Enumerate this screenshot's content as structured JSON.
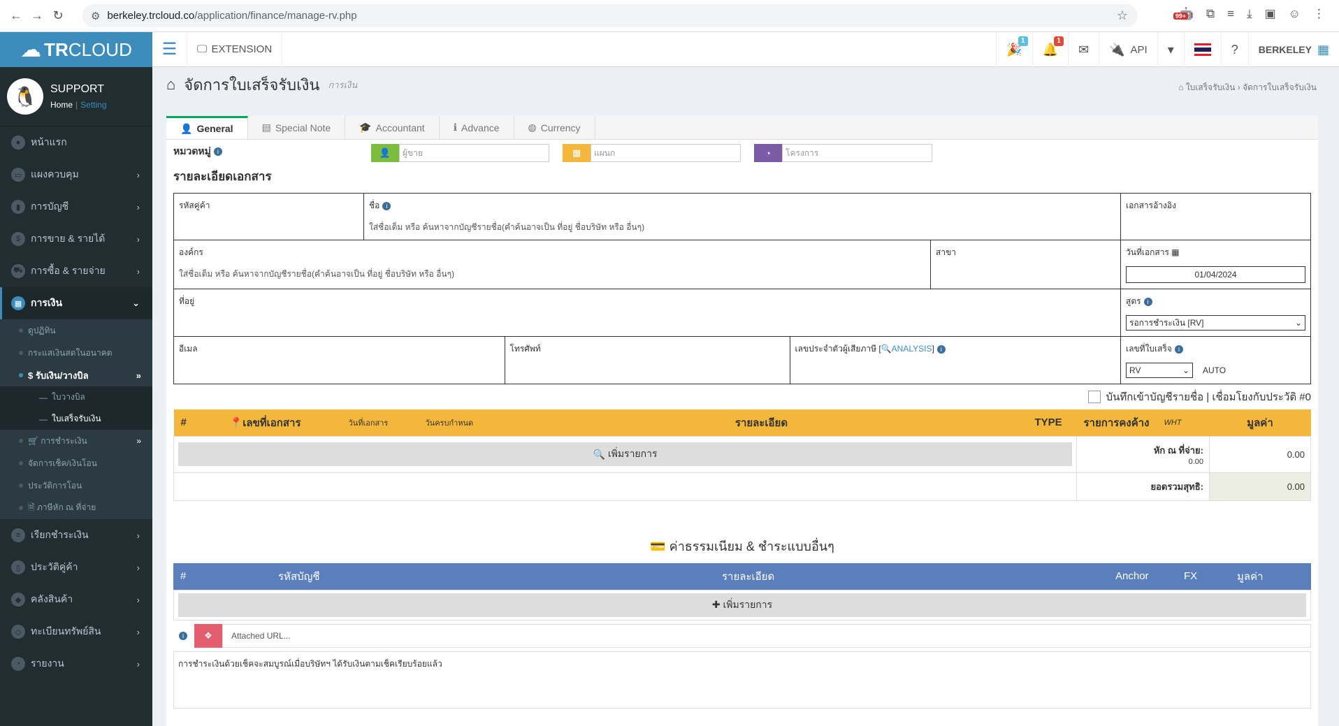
{
  "browser": {
    "url_host": "berkeley.trcloud.co",
    "url_path": "/application/finance/manage-rv.php",
    "ext_badge": "99+"
  },
  "brand": {
    "logo_bold": "TR",
    "logo_thin": "CLOUD"
  },
  "topnav": {
    "extension": "EXTENSION",
    "api": "API",
    "notify_badge": "1",
    "party_badge": "1",
    "user": "BERKELEY"
  },
  "user": {
    "name": "SUPPORT",
    "home": "Home",
    "sep": "|",
    "setting": "Setting"
  },
  "menu": [
    {
      "label": "หน้าแรก",
      "chev": ""
    },
    {
      "label": "แผงควบคุม",
      "chev": "›"
    },
    {
      "label": "การบัญชี",
      "chev": "›"
    },
    {
      "label": "การขาย & รายได้",
      "chev": "›"
    },
    {
      "label": "การซื้อ & รายจ่าย",
      "chev": "›"
    }
  ],
  "menu_active": {
    "label": "การเงิน",
    "chev": "⌄"
  },
  "submenu": [
    "ดูปฏิทิน",
    "กระแสเงินสดในอนาคต"
  ],
  "sub_active": {
    "label": "$ รับเงิน/วางบิล",
    "chev": "»"
  },
  "subsub": [
    "ใบวางบิล",
    "ใบเสร็จรับเงิน"
  ],
  "submenu2": [
    {
      "label": "🛒 การชำระเงิน",
      "chev": "»"
    },
    {
      "label": "จัดการเช็ค/เงินโอน",
      "chev": ""
    },
    {
      "label": "ประวัติการโอน",
      "chev": ""
    },
    {
      "label": "🗎 ภาษีหัก ณ ที่จ่าย",
      "chev": ""
    }
  ],
  "menu_bottom": [
    {
      "label": "เรียกชำระเงิน",
      "chev": "›"
    },
    {
      "label": "ประวัติคู่ค้า",
      "chev": "›"
    },
    {
      "label": "คลังสินค้า",
      "chev": "›"
    },
    {
      "label": "ทะเบียนทรัพย์สิน",
      "chev": "›"
    },
    {
      "label": "รายงาน",
      "chev": "›"
    }
  ],
  "page": {
    "title": "จัดการใบเสร็จรับเงิน",
    "subtitle": "การเงิน",
    "crumb1": "ใบเสร็จรับเงิน",
    "crumb2": "จัดการใบเสร็จรับเงิน"
  },
  "tabs": [
    "General",
    "Special Note",
    "Accountant",
    "Advance",
    "Currency"
  ],
  "category": {
    "label": "หมวดหมู่",
    "seller": "ผู้ขาย",
    "dept": "แผนก",
    "project": "โครงการ"
  },
  "doc": {
    "section": "รายละเอียดเอกสาร",
    "client_code": "รหัสคู่ค้า",
    "name": "ชื่อ",
    "name_hint": "ใส่ชื่อเต็ม หรือ ค้นหาจากบัญชีรายชื่อ(คำค้นอาจเป็น ที่อยู่ ชื่อบริษัท หรือ อื่นๆ)",
    "ref_doc": "เอกสารอ้างอิง",
    "org": "องค์กร",
    "org_hint": "ใส่ชื่อเต็ม หรือ ค้นหาจากบัญชีรายชื่อ(คำค้นอาจเป็น ที่อยู่ ชื่อบริษัท หรือ อื่นๆ)",
    "branch": "สาขา",
    "doc_date": "วันที่เอกสาร",
    "doc_date_val": "01/04/2024",
    "address": "ที่อยู่",
    "formula": "สูตร",
    "formula_val": "รอการชำระเงิน [RV]",
    "email": "อีเมล",
    "phone": "โทรศัพท์",
    "taxid": "เลขประจำตัวผู้เสียภาษี [",
    "analysis": "ANALYSIS",
    "taxid_end": "]",
    "receipt_no": "เลขที่ใบเสร็จ",
    "receipt_prefix": "RV",
    "auto": "AUTO"
  },
  "save_contact": "บันทึกเข้าบัญชีรายชื่อ | เชื่อมโยงกับประวัติ #0",
  "items": {
    "cols": [
      "#",
      "เลขที่เอกสาร",
      "วันที่เอกสาร",
      "วันครบกำหนด",
      "รายละเอียด",
      "TYPE",
      "รายการคงค้าง",
      "WHT",
      "มูลค่า"
    ],
    "add": "เพิ่มรายการ",
    "wht_label": "หัก ณ ที่จ่าย:",
    "wht_val": "0.00",
    "wht_total": "0.00",
    "net_label": "ยอดรวมสุทธิ:",
    "net_val": "0.00"
  },
  "fees": {
    "title": "ค่าธรรมเนียม & ชำระแบบอื่นๆ",
    "cols": [
      "#",
      "รหัสบัญชี",
      "รายละเอียด",
      "Anchor",
      "FX",
      "มูลค่า"
    ],
    "add": "เพิ่มรายการ",
    "attach_placeholder": "Attached URL..."
  },
  "note": "การชำระเงินด้วยเช็คจะสมบูรณ์เมื่อบริษัทฯ ได้รับเงินตามเช็คเรียบร้อยแล้ว",
  "colors": {
    "primary": "#3c8dbc",
    "sidebar": "#222d32",
    "items_head": "#f3b73b",
    "fees_head": "#5b7fbc",
    "green": "#7cbd3f",
    "orange": "#f3b73b",
    "purple": "#7b5aa6",
    "pink": "#e25d6e"
  }
}
